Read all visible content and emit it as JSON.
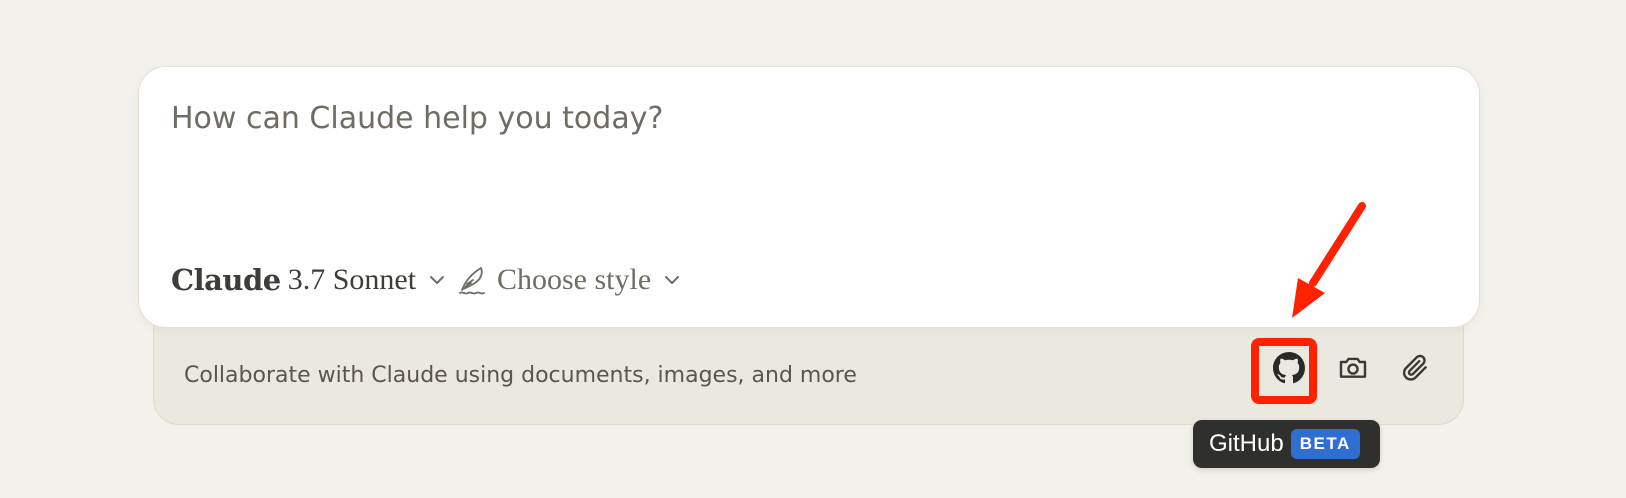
{
  "composer": {
    "placeholder": "How can Claude help you today?",
    "model": {
      "name": "Claude",
      "version": "3.7 Sonnet"
    },
    "style": {
      "label": "Choose style",
      "icon": "feather-icon"
    }
  },
  "tray": {
    "text": "Collaborate with Claude using documents, images, and more",
    "buttons": [
      {
        "icon": "github-icon",
        "label": "GitHub"
      },
      {
        "icon": "camera-icon",
        "label": "Screenshot"
      },
      {
        "icon": "paperclip-icon",
        "label": "Attach"
      }
    ]
  },
  "tooltip": {
    "title": "GitHub",
    "badge": "BETA"
  },
  "colors": {
    "background": "#f3f1eb",
    "annotation": "#ff2200",
    "badge": "#2f6fd1",
    "tooltip": "#2f2f2d"
  }
}
